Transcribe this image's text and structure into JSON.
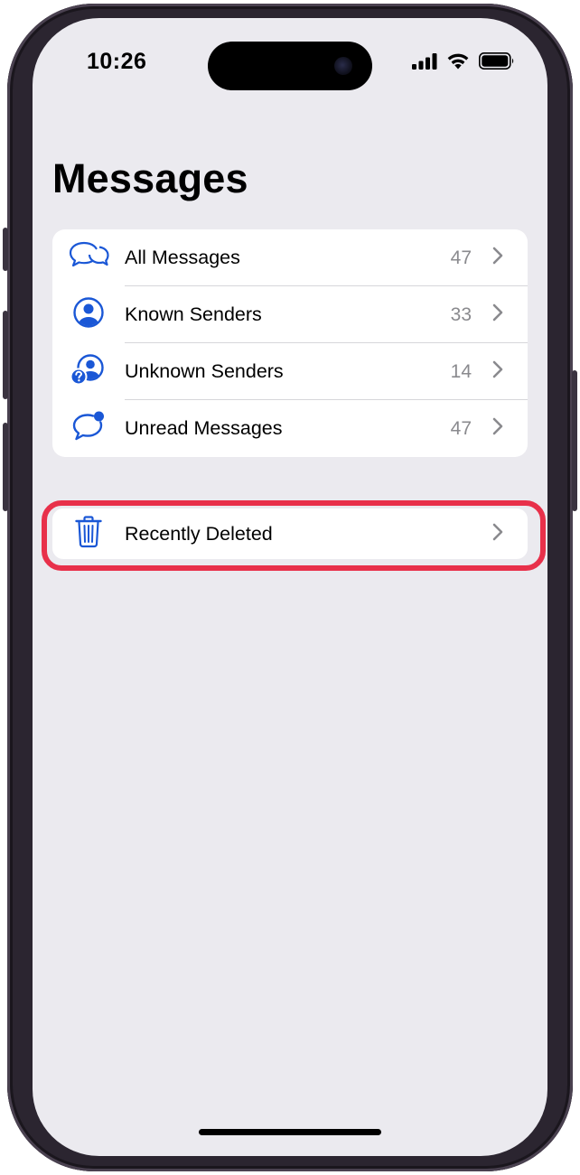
{
  "status_bar": {
    "time": "10:26",
    "icons": [
      "signal-icon",
      "wifi-icon",
      "battery-icon"
    ]
  },
  "header": {
    "title": "Messages"
  },
  "filters": [
    {
      "label": "All Messages",
      "count": "47",
      "icon": "two-speech-bubbles-icon"
    },
    {
      "label": "Known Senders",
      "count": "33",
      "icon": "person-circle-icon"
    },
    {
      "label": "Unknown Senders",
      "count": "14",
      "icon": "person-question-icon"
    },
    {
      "label": "Unread Messages",
      "count": "47",
      "icon": "speech-bubble-badge-icon"
    }
  ],
  "recently_deleted": {
    "label": "Recently Deleted",
    "icon": "trash-icon"
  },
  "colors": {
    "accent": "#1a57d6",
    "highlight": "#e8304a",
    "background": "#ebeaef",
    "count_gray": "#8a8a8e"
  }
}
